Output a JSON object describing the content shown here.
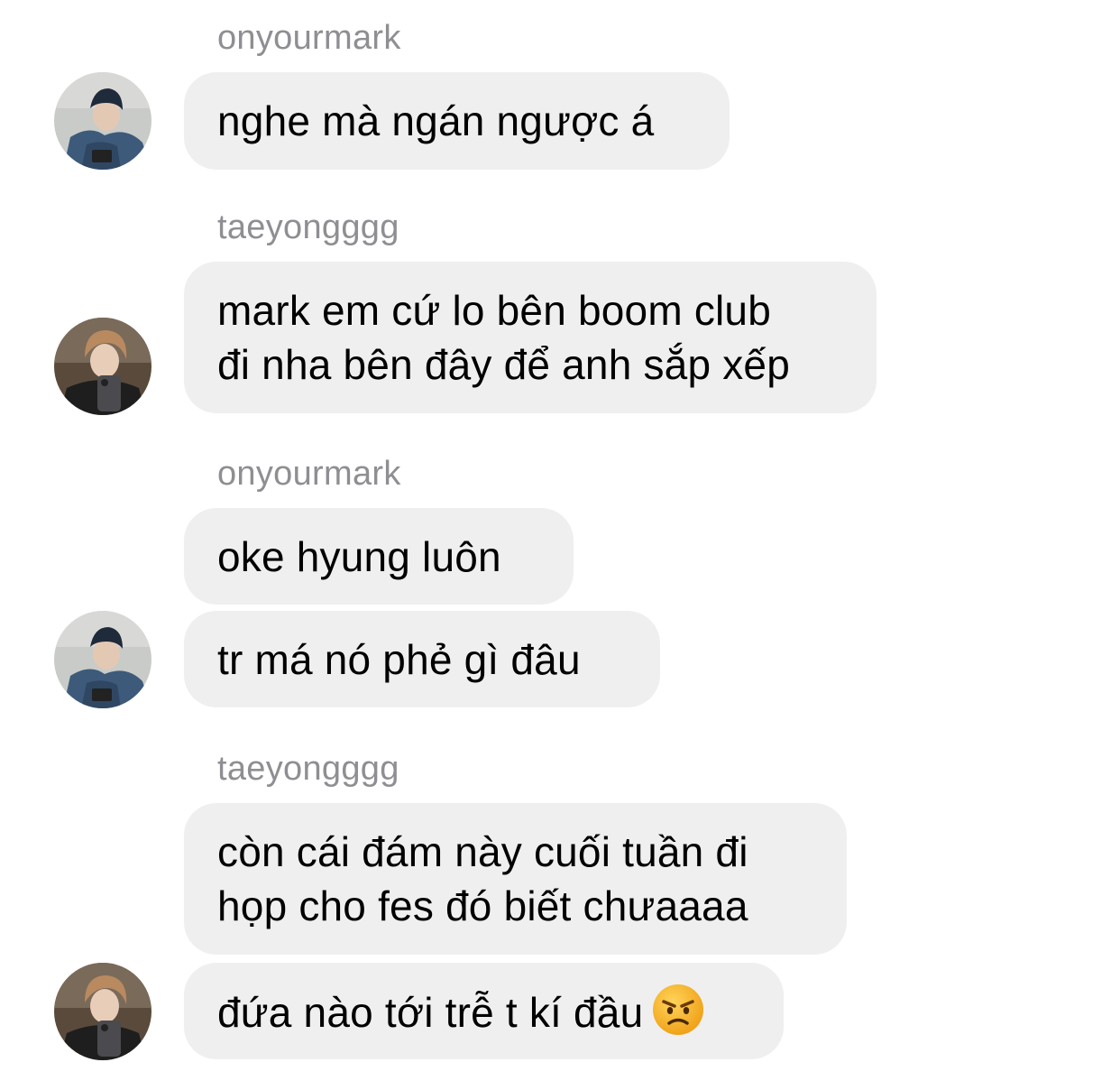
{
  "messages": [
    {
      "sender": "onyourmark",
      "lines": [
        "nghe mà ngán ngược á"
      ]
    },
    {
      "sender": "taeyongggg",
      "lines": [
        "mark em cứ lo bên boom club",
        "đi nha bên đây để anh sắp xếp"
      ]
    },
    {
      "sender": "onyourmark",
      "lines": [
        "oke hyung luôn"
      ]
    },
    {
      "sender": "",
      "lines": [
        "tr má nó phẻ gì đâu"
      ]
    },
    {
      "sender": "taeyongggg",
      "lines": [
        "còn cái đám này cuối tuần đi",
        "họp cho fes đó biết chưaaaa"
      ]
    },
    {
      "sender": "",
      "lines": [
        "đứa nào tới trễ t kí đầu"
      ],
      "emoji": "angry-face"
    }
  ],
  "colors": {
    "bubble_bg": "#efefef",
    "sender_text": "#8e8e93",
    "message_text": "#000000",
    "emoji_face": "#f7b52b"
  }
}
